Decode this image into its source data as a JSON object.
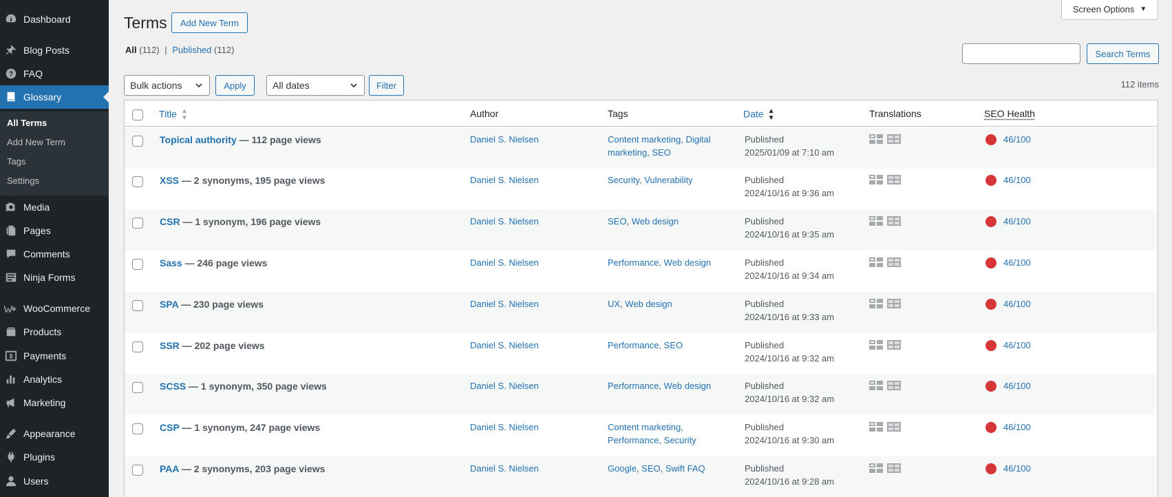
{
  "sidebar": {
    "items": [
      {
        "label": "Dashboard",
        "icon": "dashboard-icon"
      },
      {
        "label": "Blog Posts",
        "icon": "pin-icon"
      },
      {
        "label": "FAQ",
        "icon": "help-icon"
      },
      {
        "label": "Glossary",
        "icon": "book-icon",
        "active": true
      },
      {
        "label": "Media",
        "icon": "media-icon"
      },
      {
        "label": "Pages",
        "icon": "pages-icon"
      },
      {
        "label": "Comments",
        "icon": "comments-icon"
      },
      {
        "label": "Ninja Forms",
        "icon": "forms-icon"
      },
      {
        "label": "WooCommerce",
        "icon": "woocommerce-icon"
      },
      {
        "label": "Products",
        "icon": "products-icon"
      },
      {
        "label": "Payments",
        "icon": "payments-icon"
      },
      {
        "label": "Analytics",
        "icon": "analytics-icon"
      },
      {
        "label": "Marketing",
        "icon": "marketing-icon"
      },
      {
        "label": "Appearance",
        "icon": "appearance-icon"
      },
      {
        "label": "Plugins",
        "icon": "plugins-icon"
      },
      {
        "label": "Users",
        "icon": "users-icon"
      }
    ],
    "submenu": [
      "All Terms",
      "Add New Term",
      "Tags",
      "Settings"
    ]
  },
  "header": {
    "title": "Terms",
    "add_new": "Add New Term",
    "screen_options": "Screen Options"
  },
  "filters": {
    "all_label": "All",
    "all_count": "(112)",
    "published_label": "Published",
    "published_count": "(112)",
    "separator": "|",
    "bulk_actions": "Bulk actions",
    "apply": "Apply",
    "all_dates": "All dates",
    "filter": "Filter",
    "search_button": "Search Terms",
    "search_value": "",
    "items_count": "112 items"
  },
  "table": {
    "columns": {
      "title": "Title",
      "author": "Author",
      "tags": "Tags",
      "date": "Date",
      "translations": "Translations",
      "seo": "SEO Health"
    },
    "rows": [
      {
        "term": "Topical authority",
        "meta": " — 112 page views",
        "author": "Daniel S. Nielsen",
        "tags": [
          "Content marketing",
          "Digital marketing",
          "SEO"
        ],
        "status": "Published",
        "date": "2025/01/09 at 7:10 am",
        "score": "46/100"
      },
      {
        "term": "XSS",
        "meta": " — 2 synonyms, 195 page views",
        "author": "Daniel S. Nielsen",
        "tags": [
          "Security",
          "Vulnerability"
        ],
        "status": "Published",
        "date": "2024/10/16 at 9:36 am",
        "score": "46/100"
      },
      {
        "term": "CSR",
        "meta": " — 1 synonym, 196 page views",
        "author": "Daniel S. Nielsen",
        "tags": [
          "SEO",
          "Web design"
        ],
        "status": "Published",
        "date": "2024/10/16 at 9:35 am",
        "score": "46/100"
      },
      {
        "term": "Sass",
        "meta": " — 246 page views",
        "author": "Daniel S. Nielsen",
        "tags": [
          "Performance",
          "Web design"
        ],
        "status": "Published",
        "date": "2024/10/16 at 9:34 am",
        "score": "46/100"
      },
      {
        "term": "SPA",
        "meta": " — 230 page views",
        "author": "Daniel S. Nielsen",
        "tags": [
          "UX",
          "Web design"
        ],
        "status": "Published",
        "date": "2024/10/16 at 9:33 am",
        "score": "46/100"
      },
      {
        "term": "SSR",
        "meta": " — 202 page views",
        "author": "Daniel S. Nielsen",
        "tags": [
          "Performance",
          "SEO"
        ],
        "status": "Published",
        "date": "2024/10/16 at 9:32 am",
        "score": "46/100"
      },
      {
        "term": "SCSS",
        "meta": " — 1 synonym, 350 page views",
        "author": "Daniel S. Nielsen",
        "tags": [
          "Performance",
          "Web design"
        ],
        "status": "Published",
        "date": "2024/10/16 at 9:32 am",
        "score": "46/100"
      },
      {
        "term": "CSP",
        "meta": " — 1 synonym, 247 page views",
        "author": "Daniel S. Nielsen",
        "tags": [
          "Content marketing",
          "Performance",
          "Security"
        ],
        "status": "Published",
        "date": "2024/10/16 at 9:30 am",
        "score": "46/100"
      },
      {
        "term": "PAA",
        "meta": " — 2 synonyms, 203 page views",
        "author": "Daniel S. Nielsen",
        "tags": [
          "Google",
          "SEO",
          "Swift FAQ"
        ],
        "status": "Published",
        "date": "2024/10/16 at 9:28 am",
        "score": "46/100"
      }
    ]
  },
  "colors": {
    "accent": "#2271b1",
    "sidebar": "#1d2327",
    "seo_bad": "#d63638"
  }
}
